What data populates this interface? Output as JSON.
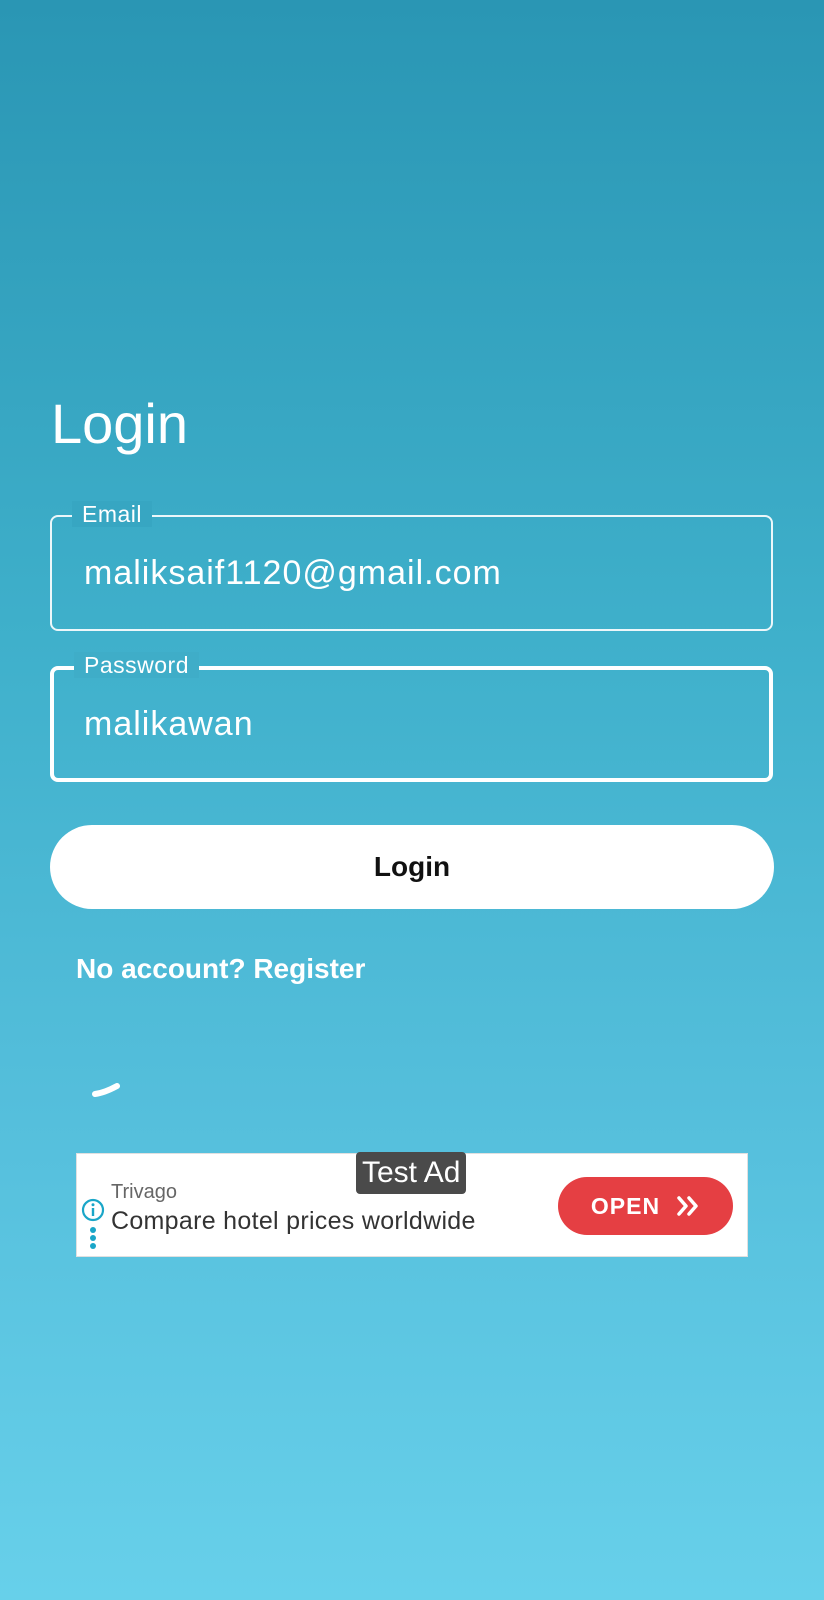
{
  "page": {
    "title": "Login"
  },
  "email_field": {
    "label": "Email",
    "value": "maliksaif1120@gmail.com"
  },
  "password_field": {
    "label": "Password",
    "value": "malikawan"
  },
  "login_button": {
    "label": "Login"
  },
  "register_link": {
    "label": "No account? Register"
  },
  "ad": {
    "badge": "Test Ad",
    "advertiser": "Trivago",
    "headline": "Compare hotel prices worldwide",
    "cta": "OPEN",
    "cta_color": "#e53f43",
    "info_icon": "info-icon",
    "menu_icon": "more-vert-icon",
    "cta_icon": "double-chevron-right-icon"
  },
  "colors": {
    "background_top": "#2a96b4",
    "background_bottom": "#67d0ea",
    "accent_text": "#ffffff"
  }
}
